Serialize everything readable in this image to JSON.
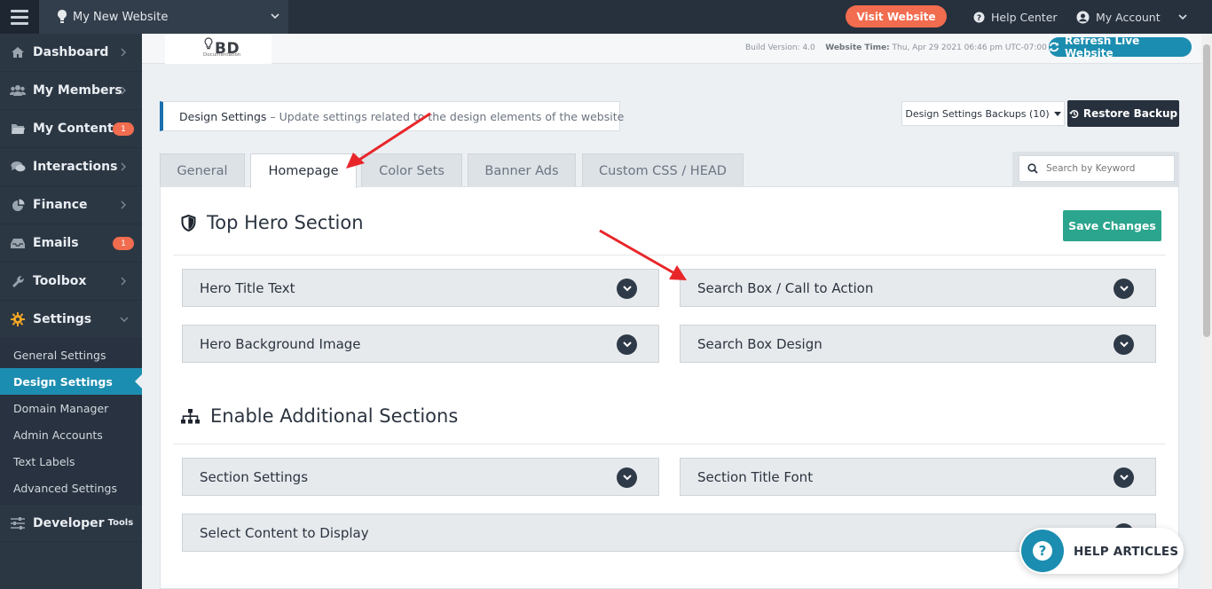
{
  "topbar": {
    "site_name": "My New Website",
    "visit_label": "Visit Website",
    "help_center": "Help Center",
    "my_account": "My Account"
  },
  "sidebar": {
    "items": [
      {
        "label": "Dashboard",
        "icon": "home-icon"
      },
      {
        "label": "My Members",
        "icon": "users-icon"
      },
      {
        "label": "My Content",
        "icon": "folder-icon",
        "badge": "1"
      },
      {
        "label": "Interactions",
        "icon": "comments-icon"
      },
      {
        "label": "Finance",
        "icon": "pie-chart-icon"
      },
      {
        "label": "Emails",
        "icon": "inbox-icon",
        "badge": "1"
      },
      {
        "label": "Toolbox",
        "icon": "wrench-icon"
      },
      {
        "label": "Settings",
        "icon": "gear-icon"
      }
    ],
    "submenu": [
      "General Settings",
      "Design Settings",
      "Domain Manager",
      "Admin Accounts",
      "Text Labels",
      "Advanced Settings"
    ],
    "developer": {
      "label": "Developer",
      "suffix": "Tools"
    }
  },
  "header": {
    "logo": "BD",
    "logo_sub": "Documentation",
    "build_label": "Build Version: 4.0",
    "time_label": "Website Time:",
    "time_value": "Thu, Apr 29 2021 06:46 pm UTC-07:00",
    "refresh_label": "Refresh Live Website"
  },
  "page": {
    "info_title": "Design Settings",
    "info_desc": "– Update settings related to the design elements of the website",
    "backups_label": "Design Settings Backups (10)",
    "restore_label": "Restore Backup",
    "search_placeholder": "Search by Keyword",
    "tabs": [
      "General",
      "Homepage",
      "Color Sets",
      "Banner Ads",
      "Custom CSS / HEAD"
    ],
    "save_label": "Save Changes"
  },
  "sections": {
    "hero_title": "Top Hero Section",
    "hero_items": [
      "Hero Title Text",
      "Search Box / Call to Action",
      "Hero Background Image",
      "Search Box Design"
    ],
    "additional_title": "Enable Additional Sections",
    "additional_items": [
      "Section Settings",
      "Section Title Font",
      "Select Content to Display"
    ]
  },
  "help_articles": "HELP ARTICLES",
  "colors": {
    "accent": "#1b8db0",
    "visit": "#f26c4f",
    "save": "#2ba58d",
    "annotation_arrow": "#e8262a"
  }
}
